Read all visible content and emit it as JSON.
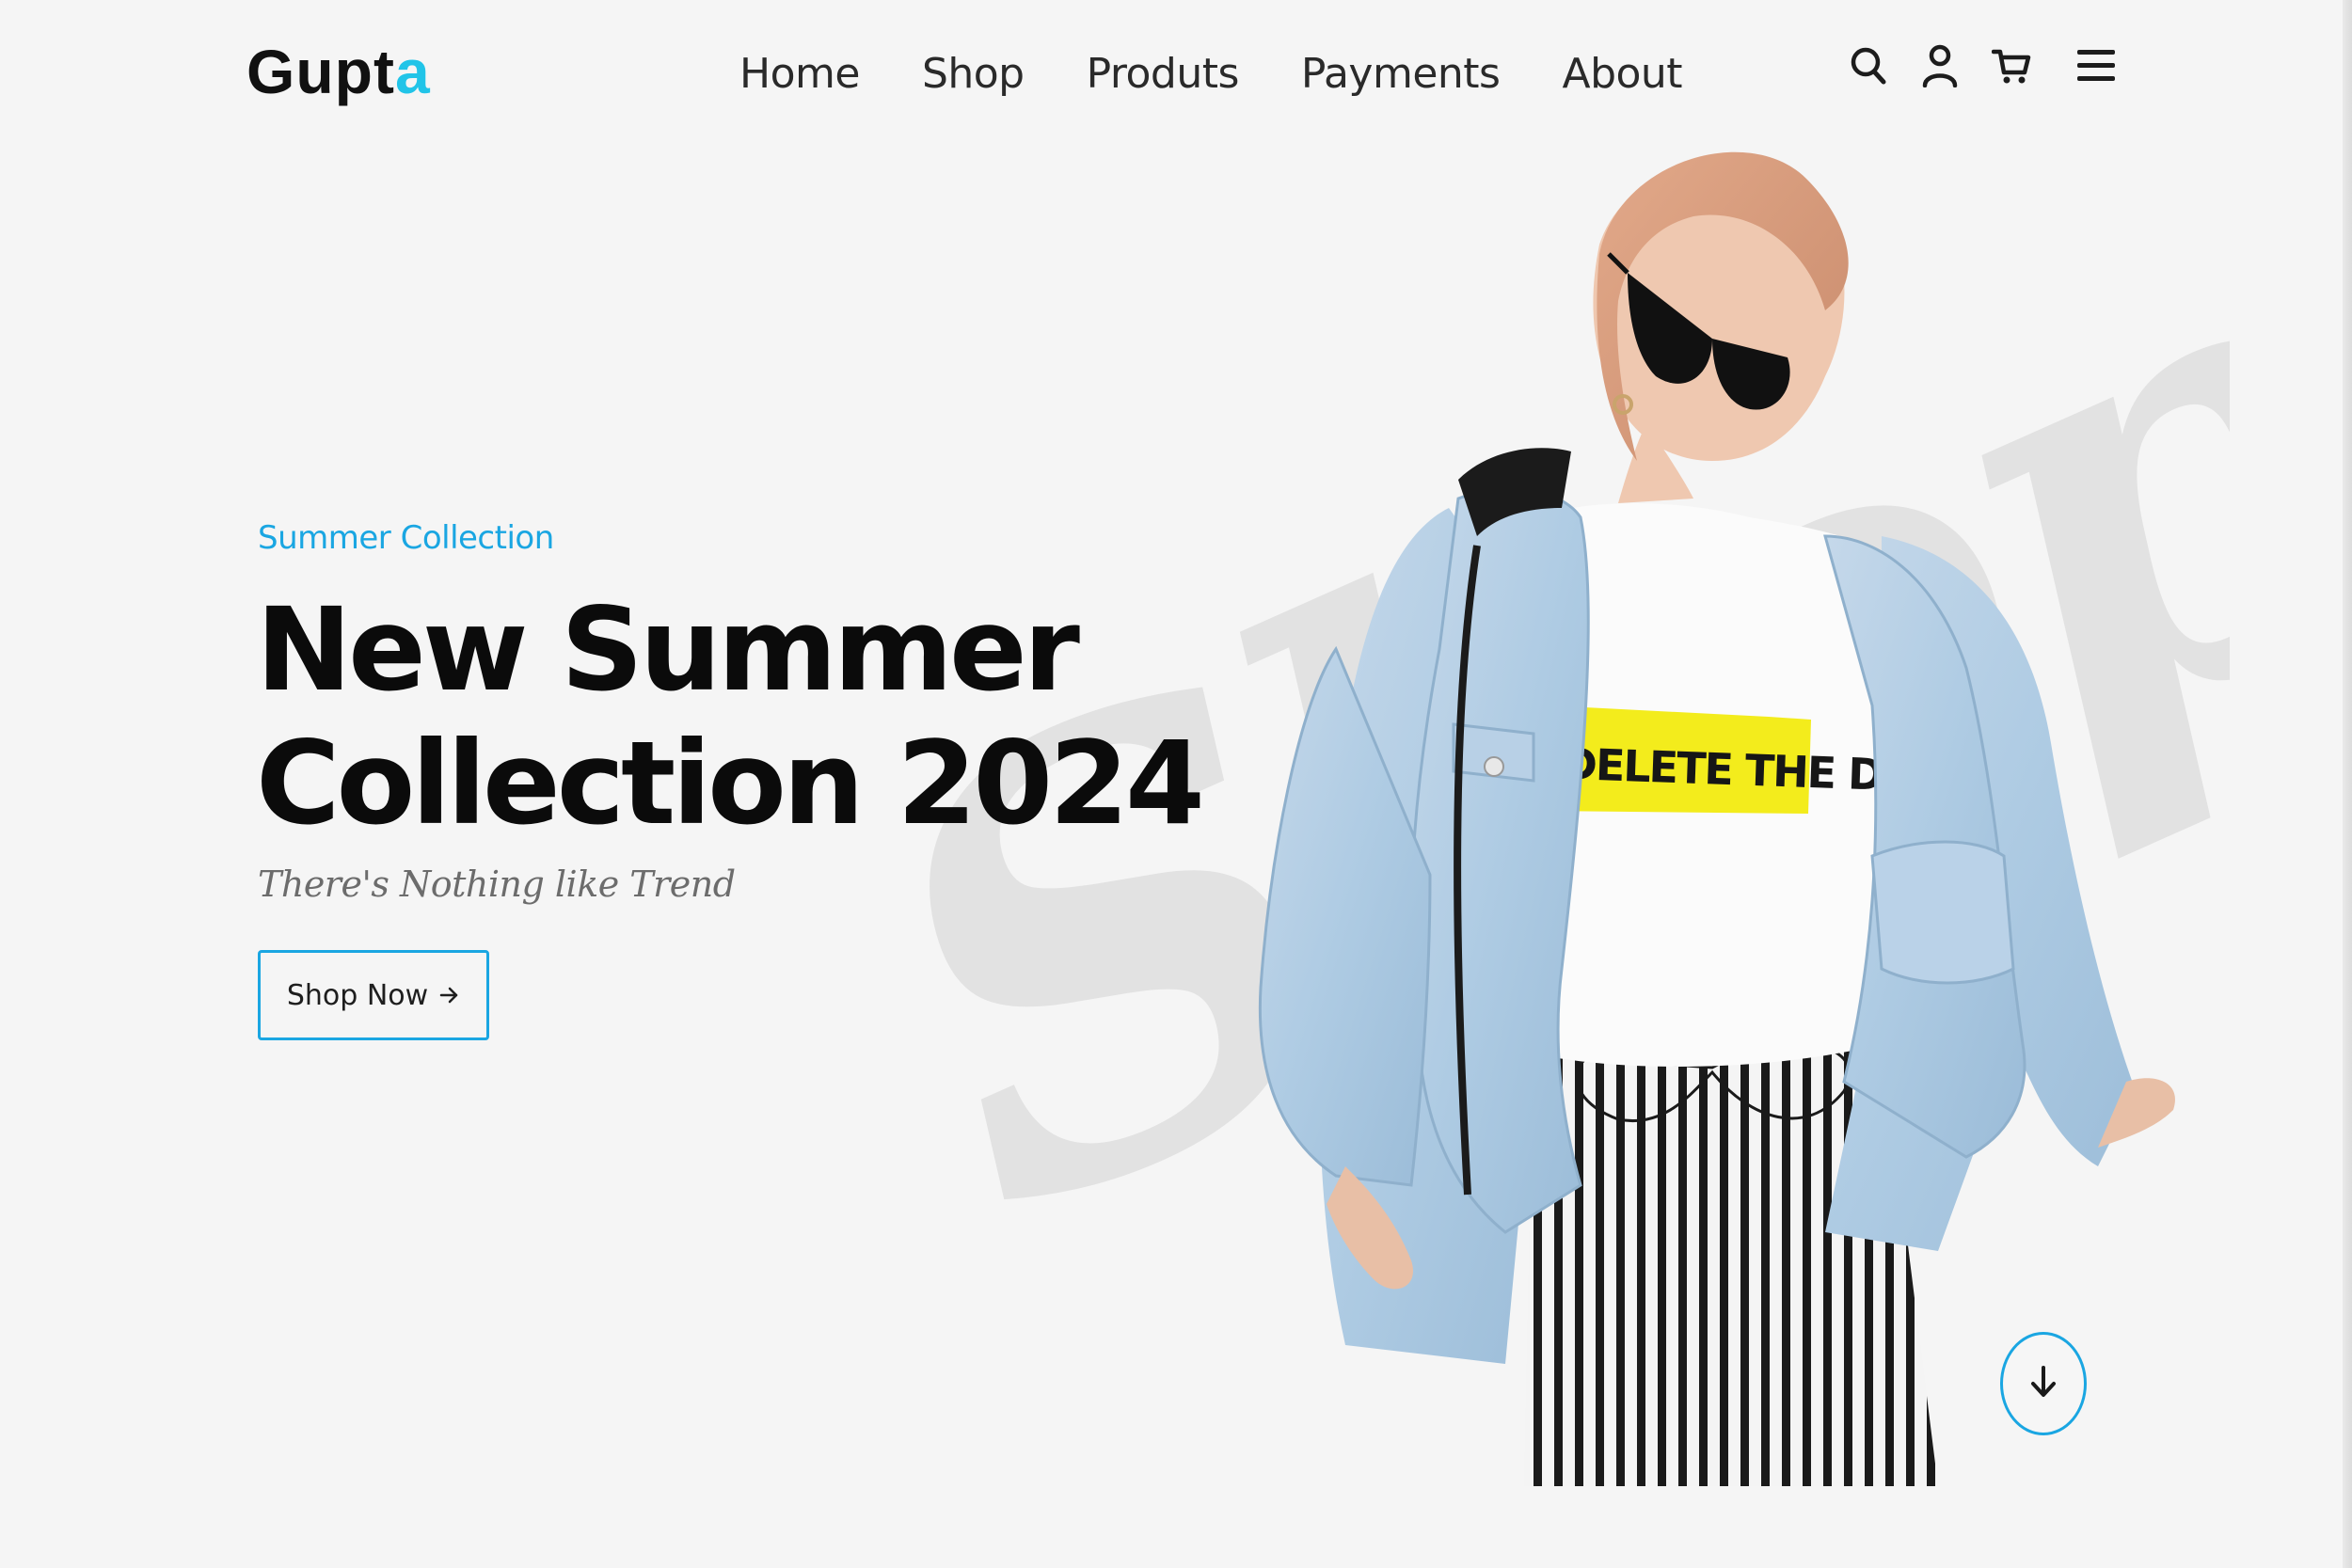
{
  "header": {
    "logo_main": "Gupt",
    "logo_accent": "a",
    "nav": [
      {
        "label": "Home"
      },
      {
        "label": "Shop"
      },
      {
        "label": "Produts"
      },
      {
        "label": "Payments"
      },
      {
        "label": "About"
      }
    ],
    "icons": [
      "search-icon",
      "user-icon",
      "cart-icon",
      "menu-icon"
    ]
  },
  "hero": {
    "eyebrow": "Summer Collection",
    "title_line1": "New Summer",
    "title_line2": "Collection 2024",
    "subtitle": "There's Nothing like Trend",
    "cta_label": "Shop Now",
    "cta_icon": "arrow-right-icon",
    "watermark_text": "Shopnis",
    "tshirt_print": "DELETE THE DRAM",
    "scroll_icon": "arrow-down-icon"
  },
  "colors": {
    "accent": "#1aa6e2",
    "logo_accent": "#21c4e8",
    "background": "#f5f5f5",
    "text": "#0b0b0b"
  }
}
